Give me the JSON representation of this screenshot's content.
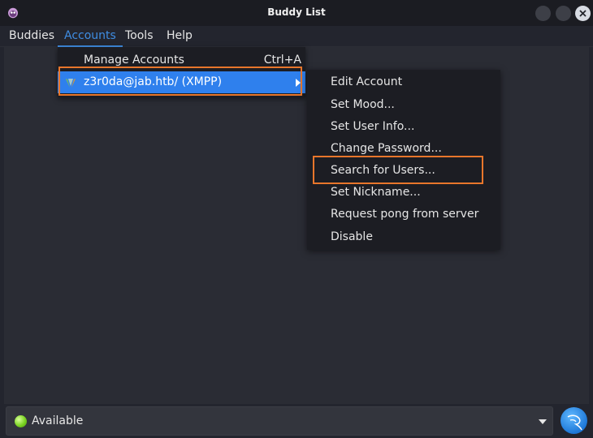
{
  "window": {
    "title": "Buddy List"
  },
  "menubar": {
    "items": [
      {
        "label": "Buddies"
      },
      {
        "label": "Accounts"
      },
      {
        "label": "Tools"
      },
      {
        "label": "Help"
      }
    ]
  },
  "accounts_menu": {
    "manage": {
      "label": "Manage Accounts",
      "shortcut": "Ctrl+A"
    },
    "account": {
      "label": "z3r0da@jab.htb/ (XMPP)"
    }
  },
  "account_submenu": {
    "items": [
      "Edit Account",
      "Set Mood...",
      "Set User Info...",
      "Change Password...",
      "Search for Users...",
      "Set Nickname...",
      "Request pong from server",
      "Disable"
    ]
  },
  "status": {
    "label": "Available",
    "color": "#7ad321"
  },
  "colors": {
    "accent": "#2f80ed",
    "highlight_outline": "#e8762b"
  }
}
